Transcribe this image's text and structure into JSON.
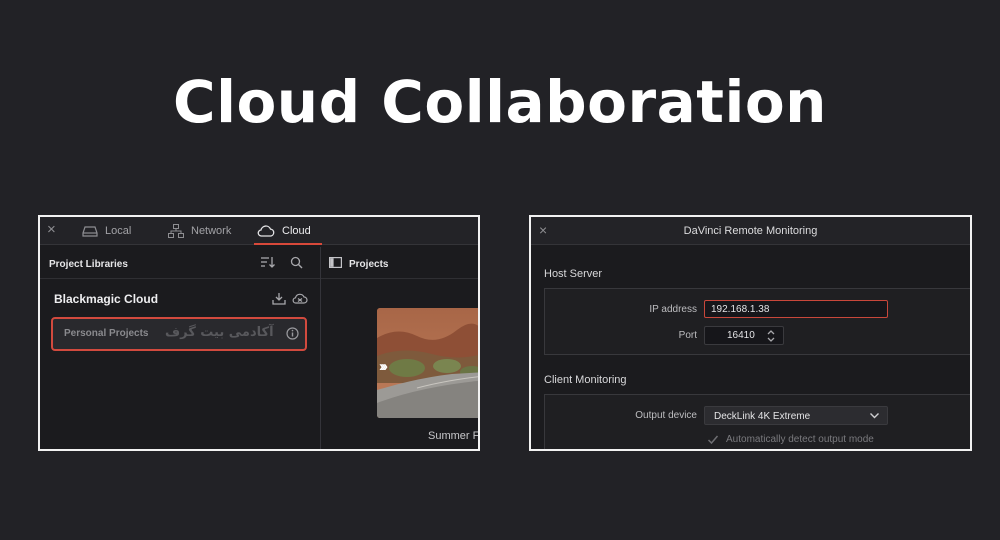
{
  "page": {
    "title": "Cloud Collaboration"
  },
  "left_window": {
    "close_glyph": "×",
    "tabs": [
      {
        "label": "Local",
        "icon": "drive-icon"
      },
      {
        "label": "Network",
        "icon": "network-icon"
      },
      {
        "label": "Cloud",
        "icon": "cloud-icon",
        "active": true
      }
    ],
    "libraries_header": "Project Libraries",
    "library_name": "Blackmagic Cloud",
    "personal_projects": "Personal Projects",
    "watermark_text": "آکادمی بیت گرف",
    "projects_header": "Projects",
    "project_thumb_label": "Summer F",
    "accent_color": "#d24a3e"
  },
  "right_window": {
    "close_glyph": "×",
    "title": "DaVinci Remote Monitoring",
    "host_server": {
      "section": "Host Server",
      "ip_label": "IP address",
      "ip_value": "192.168.1.38",
      "port_label": "Port",
      "port_value": "16410"
    },
    "client_monitoring": {
      "section": "Client Monitoring",
      "output_label": "Output device",
      "output_value": "DeckLink 4K Extreme",
      "auto_detect_label": "Automatically detect output mode"
    }
  }
}
